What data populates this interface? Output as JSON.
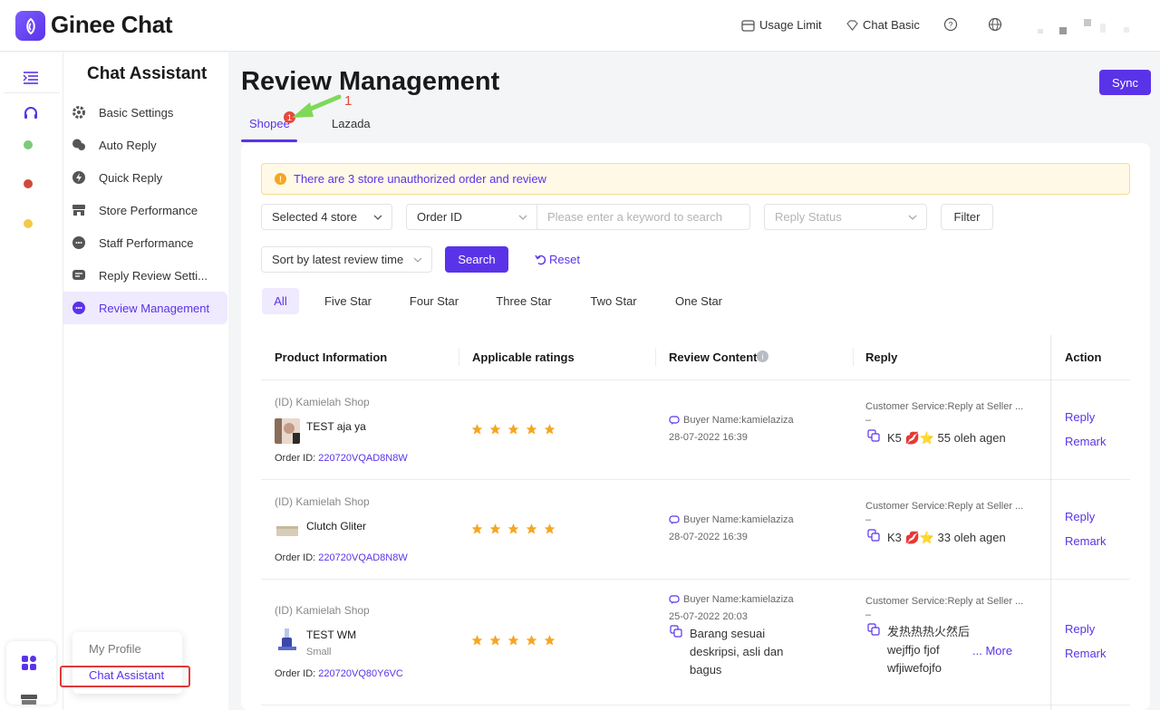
{
  "app": {
    "brand": "Ginee Chat"
  },
  "topbar": {
    "usage_limit": "Usage Limit",
    "plan": "Chat Basic"
  },
  "sidebar": {
    "title": "Chat Assistant",
    "items": [
      {
        "label": "Basic Settings",
        "icon": "gear-icon"
      },
      {
        "label": "Auto Reply",
        "icon": "chat-bubbles-icon"
      },
      {
        "label": "Quick Reply",
        "icon": "lightning-icon"
      },
      {
        "label": "Store Performance",
        "icon": "store-icon"
      },
      {
        "label": "Staff Performance",
        "icon": "staff-icon"
      },
      {
        "label": "Reply Review Setti...",
        "icon": "review-settings-icon"
      },
      {
        "label": "Review Management",
        "icon": "review-icon"
      }
    ]
  },
  "popup": {
    "profile": "My Profile",
    "assistant": "Chat Assistant"
  },
  "page": {
    "title": "Review Management",
    "sync": "Sync",
    "tabs": [
      {
        "label": "Shopee",
        "badge": "1"
      },
      {
        "label": "Lazada"
      }
    ],
    "annotation": "1"
  },
  "notice": "There are 3 store unauthorized order and review",
  "filters": {
    "store": "Selected 4 store",
    "field": "Order ID",
    "keyword_placeholder": "Please enter a keyword to search",
    "reply_status_placeholder": "Reply Status",
    "filter_button": "Filter",
    "sort": "Sort by latest review time",
    "search": "Search",
    "reset": "Reset"
  },
  "star_tabs": [
    "All",
    "Five Star",
    "Four Star",
    "Three Star",
    "Two Star",
    "One Star"
  ],
  "table": {
    "headers": [
      "Product Information",
      "Applicable ratings",
      "Review Content",
      "Reply",
      "Action"
    ],
    "rows": [
      {
        "shop": "(ID) Kamielah Shop",
        "product": "TEST aja ya",
        "variant": "",
        "order_label": "Order ID: ",
        "order_id": "220720VQAD8N8W",
        "rating": 5,
        "buyer": "Buyer Name:kamielaziza",
        "date": "28-07-2022 16:39",
        "review": "",
        "reply_header": "Customer Service:Reply at Seller ...",
        "reply_dash": "–",
        "reply": "K5 💋⭐ 55 oleh agen",
        "actions": [
          "Reply",
          "Remark"
        ]
      },
      {
        "shop": "(ID) Kamielah Shop",
        "product": "Clutch Gliter",
        "variant": "",
        "order_label": "Order ID: ",
        "order_id": "220720VQAD8N8W",
        "rating": 5,
        "buyer": "Buyer Name:kamielaziza",
        "date": "28-07-2022 16:39",
        "review": "",
        "reply_header": "Customer Service:Reply at Seller ...",
        "reply_dash": "–",
        "reply": "K3 💋⭐ 33 oleh agen",
        "actions": [
          "Reply",
          "Remark"
        ]
      },
      {
        "shop": "(ID) Kamielah Shop",
        "product": "TEST WM",
        "variant": "Small",
        "order_label": "Order ID: ",
        "order_id": "220720VQ80Y6VC",
        "rating": 5,
        "buyer": "Buyer Name:kamielaziza",
        "date": "25-07-2022 20:03",
        "review_lines": [
          "Barang sesuai",
          "deskripsi, asli dan",
          "bagus"
        ],
        "reply_header": "Customer Service:Reply at Seller ...",
        "reply_dash": "–",
        "reply_lines": [
          "发热热热火然后",
          "wejffjo fjof",
          "wfjiwefojfo"
        ],
        "more": "... More",
        "actions": [
          "Reply",
          "Remark"
        ]
      }
    ]
  },
  "colors": {
    "accent": "#5a33e8",
    "star": "#f5a623",
    "badge": "#e5483c"
  }
}
